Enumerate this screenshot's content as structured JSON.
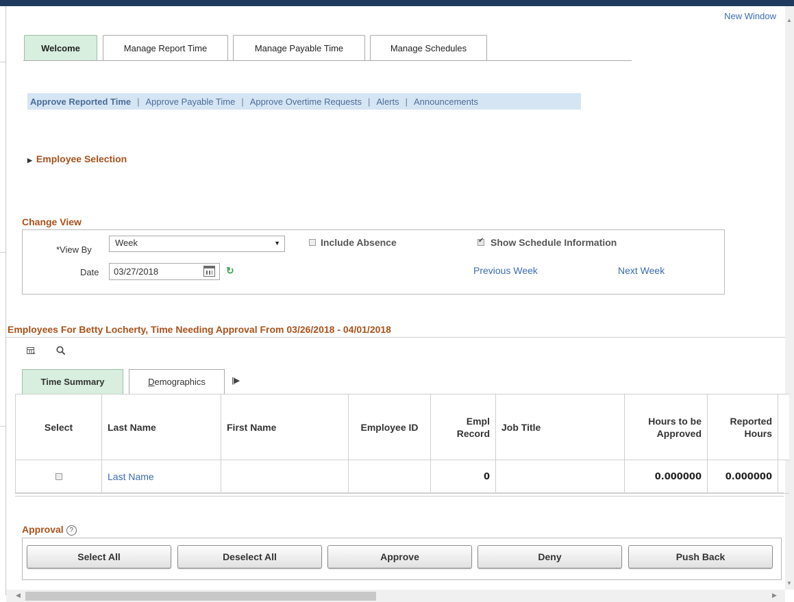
{
  "header": {
    "new_window": "New Window"
  },
  "tabs": [
    "Welcome",
    "Manage Report Time",
    "Manage Payable Time",
    "Manage Schedules"
  ],
  "subnav": {
    "items": [
      "Approve Reported Time",
      "Approve Payable Time",
      "Approve Overtime Requests",
      "Alerts",
      "Announcements"
    ],
    "separator": "|"
  },
  "employee_selection": {
    "title": "Employee Selection"
  },
  "change_view": {
    "title": "Change View",
    "view_by_label": "*View By",
    "view_by_value": "Week",
    "date_label": "Date",
    "date_value": "03/27/2018",
    "include_absence": {
      "label": "Include Absence",
      "checked": false
    },
    "show_schedule": {
      "label": "Show Schedule Information",
      "checked": true
    },
    "previous_week": "Previous Week",
    "next_week": "Next Week"
  },
  "grid": {
    "title": "Employees For Betty Locherty, Time Needing Approval From 03/26/2018 - 04/01/2018",
    "tabs": {
      "time_summary": "Time Summary",
      "demographics_first": "D",
      "demographics_rest": "emographics"
    },
    "columns": [
      "Select",
      "Last Name",
      "First Name",
      "Employee ID",
      "Empl Record",
      "Job Title",
      "Hours to be Approved",
      "Reported Hours"
    ],
    "column_lines": {
      "empl_record": [
        "Empl",
        "Record"
      ],
      "hours_to_approve": [
        "Hours to be",
        "Approved"
      ],
      "reported_hours": [
        "Reported",
        "Hours"
      ]
    },
    "rows": [
      {
        "selected": false,
        "last_name": "Last Name",
        "first_name": "",
        "employee_id": "",
        "empl_record": "0",
        "job_title": "",
        "hours_to_be_approved": "0.000000",
        "reported_hours": "0.000000"
      }
    ]
  },
  "approval": {
    "title": "Approval",
    "help": "?",
    "buttons": [
      "Select All",
      "Deselect All",
      "Approve",
      "Deny",
      "Push Back"
    ]
  },
  "colors": {
    "section_title": "#a8511a",
    "active_tab": "#d8eede",
    "subnav_bg": "#d6e5f4",
    "link": "#3b6bb3"
  }
}
